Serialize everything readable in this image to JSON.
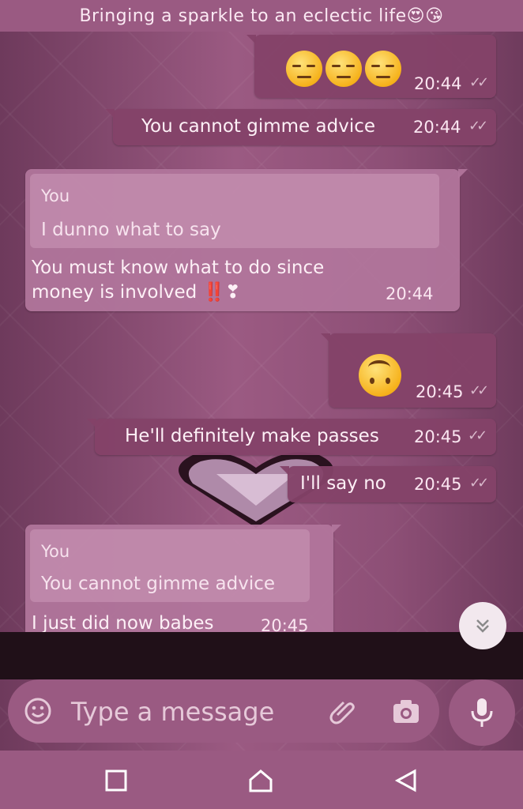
{
  "status_banner": {
    "text": "Bringing a sparkle to an eclectic life😍😘"
  },
  "messages": [
    {
      "direction": "out",
      "type": "emoji",
      "text": "😒😒😒",
      "time": "20:44",
      "read_ticks": "✓✓"
    },
    {
      "direction": "out",
      "type": "text",
      "text": "You cannot gimme advice",
      "time": "20:44",
      "read_ticks": "✓✓"
    },
    {
      "direction": "in",
      "type": "reply",
      "quote_author": "You",
      "quote_text": "I dunno what to say",
      "text_line1": "You must know what to do since",
      "text_line2": "money is involved ‼️❣",
      "time": "20:44"
    },
    {
      "direction": "out",
      "type": "emoji",
      "text": "🙃",
      "time": "20:45",
      "read_ticks": "✓✓"
    },
    {
      "direction": "out",
      "type": "text",
      "text": "He'll definitely make passes",
      "time": "20:45",
      "read_ticks": "✓✓"
    },
    {
      "direction": "out",
      "type": "text",
      "text": "I'll say no",
      "time": "20:45",
      "read_ticks": "✓✓"
    },
    {
      "direction": "in",
      "type": "reply",
      "quote_author": "You",
      "quote_text": "You cannot gimme advice",
      "text_line1": "I just did now babes",
      "time": "20:45"
    }
  ],
  "composer": {
    "placeholder": "Type a message",
    "emoji_icon": "emoji-icon",
    "attach_icon": "paperclip-icon",
    "camera_icon": "camera-icon",
    "mic_icon": "microphone-icon"
  },
  "scroll_button_icon": "double-chevron-down-icon",
  "nav": {
    "recents_icon": "square-icon",
    "home_icon": "home-icon",
    "back_icon": "triangle-back-icon"
  },
  "colors": {
    "banner_bg": "#9a5a82",
    "outgoing_bubble": "#844268",
    "incoming_bubble": "#b2769c",
    "wallpaper": "#8d4f76"
  }
}
